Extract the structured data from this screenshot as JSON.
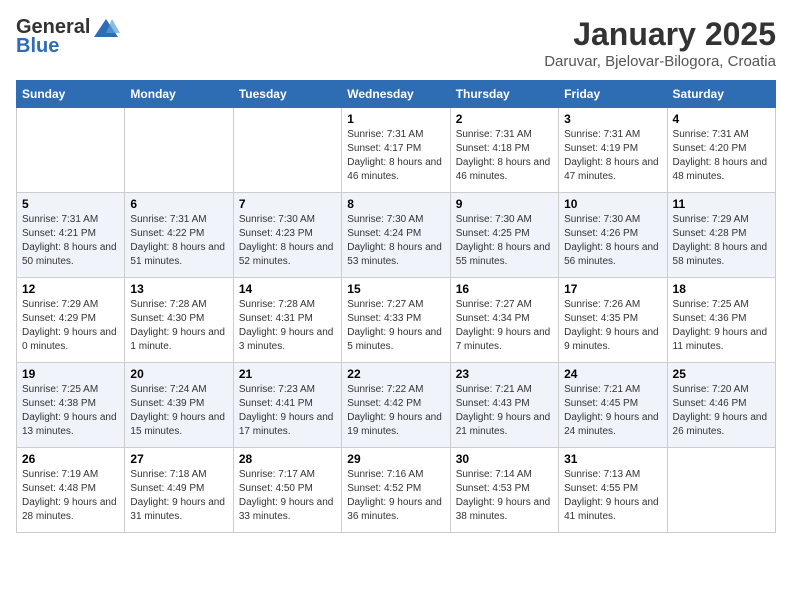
{
  "header": {
    "logo_general": "General",
    "logo_blue": "Blue",
    "title": "January 2025",
    "location": "Daruvar, Bjelovar-Bilogora, Croatia"
  },
  "weekdays": [
    "Sunday",
    "Monday",
    "Tuesday",
    "Wednesday",
    "Thursday",
    "Friday",
    "Saturday"
  ],
  "weeks": [
    [
      {
        "day": "",
        "info": ""
      },
      {
        "day": "",
        "info": ""
      },
      {
        "day": "",
        "info": ""
      },
      {
        "day": "1",
        "info": "Sunrise: 7:31 AM\nSunset: 4:17 PM\nDaylight: 8 hours and 46 minutes."
      },
      {
        "day": "2",
        "info": "Sunrise: 7:31 AM\nSunset: 4:18 PM\nDaylight: 8 hours and 46 minutes."
      },
      {
        "day": "3",
        "info": "Sunrise: 7:31 AM\nSunset: 4:19 PM\nDaylight: 8 hours and 47 minutes."
      },
      {
        "day": "4",
        "info": "Sunrise: 7:31 AM\nSunset: 4:20 PM\nDaylight: 8 hours and 48 minutes."
      }
    ],
    [
      {
        "day": "5",
        "info": "Sunrise: 7:31 AM\nSunset: 4:21 PM\nDaylight: 8 hours and 50 minutes."
      },
      {
        "day": "6",
        "info": "Sunrise: 7:31 AM\nSunset: 4:22 PM\nDaylight: 8 hours and 51 minutes."
      },
      {
        "day": "7",
        "info": "Sunrise: 7:30 AM\nSunset: 4:23 PM\nDaylight: 8 hours and 52 minutes."
      },
      {
        "day": "8",
        "info": "Sunrise: 7:30 AM\nSunset: 4:24 PM\nDaylight: 8 hours and 53 minutes."
      },
      {
        "day": "9",
        "info": "Sunrise: 7:30 AM\nSunset: 4:25 PM\nDaylight: 8 hours and 55 minutes."
      },
      {
        "day": "10",
        "info": "Sunrise: 7:30 AM\nSunset: 4:26 PM\nDaylight: 8 hours and 56 minutes."
      },
      {
        "day": "11",
        "info": "Sunrise: 7:29 AM\nSunset: 4:28 PM\nDaylight: 8 hours and 58 minutes."
      }
    ],
    [
      {
        "day": "12",
        "info": "Sunrise: 7:29 AM\nSunset: 4:29 PM\nDaylight: 9 hours and 0 minutes."
      },
      {
        "day": "13",
        "info": "Sunrise: 7:28 AM\nSunset: 4:30 PM\nDaylight: 9 hours and 1 minute."
      },
      {
        "day": "14",
        "info": "Sunrise: 7:28 AM\nSunset: 4:31 PM\nDaylight: 9 hours and 3 minutes."
      },
      {
        "day": "15",
        "info": "Sunrise: 7:27 AM\nSunset: 4:33 PM\nDaylight: 9 hours and 5 minutes."
      },
      {
        "day": "16",
        "info": "Sunrise: 7:27 AM\nSunset: 4:34 PM\nDaylight: 9 hours and 7 minutes."
      },
      {
        "day": "17",
        "info": "Sunrise: 7:26 AM\nSunset: 4:35 PM\nDaylight: 9 hours and 9 minutes."
      },
      {
        "day": "18",
        "info": "Sunrise: 7:25 AM\nSunset: 4:36 PM\nDaylight: 9 hours and 11 minutes."
      }
    ],
    [
      {
        "day": "19",
        "info": "Sunrise: 7:25 AM\nSunset: 4:38 PM\nDaylight: 9 hours and 13 minutes."
      },
      {
        "day": "20",
        "info": "Sunrise: 7:24 AM\nSunset: 4:39 PM\nDaylight: 9 hours and 15 minutes."
      },
      {
        "day": "21",
        "info": "Sunrise: 7:23 AM\nSunset: 4:41 PM\nDaylight: 9 hours and 17 minutes."
      },
      {
        "day": "22",
        "info": "Sunrise: 7:22 AM\nSunset: 4:42 PM\nDaylight: 9 hours and 19 minutes."
      },
      {
        "day": "23",
        "info": "Sunrise: 7:21 AM\nSunset: 4:43 PM\nDaylight: 9 hours and 21 minutes."
      },
      {
        "day": "24",
        "info": "Sunrise: 7:21 AM\nSunset: 4:45 PM\nDaylight: 9 hours and 24 minutes."
      },
      {
        "day": "25",
        "info": "Sunrise: 7:20 AM\nSunset: 4:46 PM\nDaylight: 9 hours and 26 minutes."
      }
    ],
    [
      {
        "day": "26",
        "info": "Sunrise: 7:19 AM\nSunset: 4:48 PM\nDaylight: 9 hours and 28 minutes."
      },
      {
        "day": "27",
        "info": "Sunrise: 7:18 AM\nSunset: 4:49 PM\nDaylight: 9 hours and 31 minutes."
      },
      {
        "day": "28",
        "info": "Sunrise: 7:17 AM\nSunset: 4:50 PM\nDaylight: 9 hours and 33 minutes."
      },
      {
        "day": "29",
        "info": "Sunrise: 7:16 AM\nSunset: 4:52 PM\nDaylight: 9 hours and 36 minutes."
      },
      {
        "day": "30",
        "info": "Sunrise: 7:14 AM\nSunset: 4:53 PM\nDaylight: 9 hours and 38 minutes."
      },
      {
        "day": "31",
        "info": "Sunrise: 7:13 AM\nSunset: 4:55 PM\nDaylight: 9 hours and 41 minutes."
      },
      {
        "day": "",
        "info": ""
      }
    ]
  ]
}
